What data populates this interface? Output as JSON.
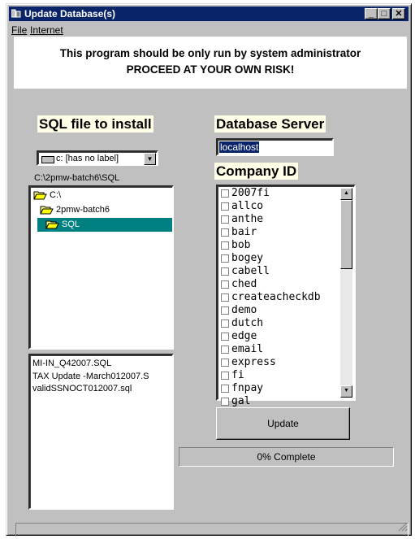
{
  "window": {
    "title": "Update Database(s)"
  },
  "menu": {
    "file_label": "File",
    "internet_label": "Internet"
  },
  "warning": {
    "line1": "This program should be only run by system administrator",
    "line2": "PROCEED AT YOUR OWN RISK!"
  },
  "left": {
    "header": "SQL file to install",
    "drive": "c: [has no label]",
    "path": "C:\\2pmw-batch6\\SQL",
    "dirs": [
      "C:\\",
      "2pmw-batch6",
      "SQL"
    ],
    "files": [
      "MI-IN_Q42007.SQL",
      "TAX Update -March012007.S",
      "validSSNOCT012007.sql"
    ]
  },
  "right": {
    "server_header": "Database Server",
    "server_value": "localhost",
    "company_header": "Company ID",
    "companies": [
      "2007fi",
      "allco",
      "anthe",
      "bair",
      "bob",
      "bogey",
      "cabell",
      "ched",
      "createacheckdb",
      "demo",
      "dutch",
      "edge",
      "email",
      "express",
      "fi",
      "fnpay",
      "gal"
    ]
  },
  "actions": {
    "update_label": "Update",
    "progress_text": "0% Complete"
  },
  "colors": {
    "titlebar": "#0a246a",
    "selection": "#008080",
    "face": "#c0c0c0"
  }
}
